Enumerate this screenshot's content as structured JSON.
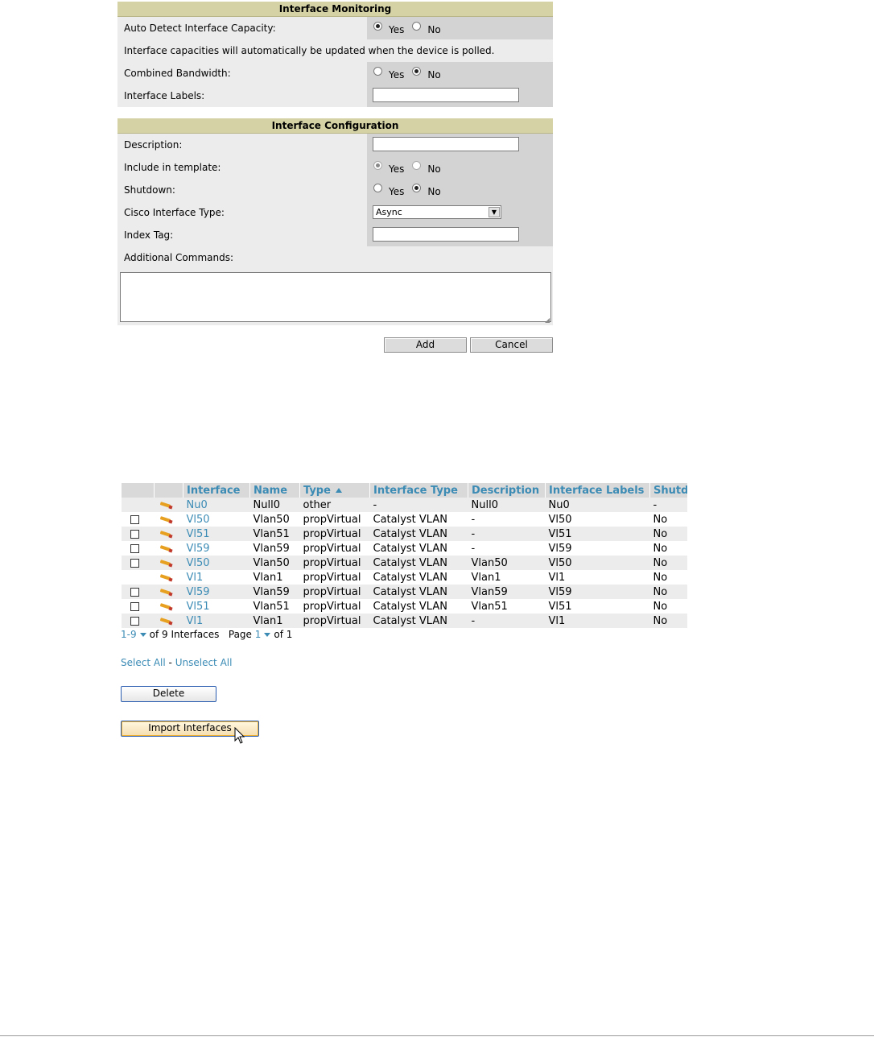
{
  "monitoring": {
    "title": "Interface Monitoring",
    "auto_detect_label": "Auto Detect Interface Capacity:",
    "auto_detect_yes": "Yes",
    "auto_detect_no": "No",
    "auto_detect_selected": "Yes",
    "note": "Interface capacities will automatically be updated when the device is polled.",
    "combined_label": "Combined Bandwidth:",
    "combined_yes": "Yes",
    "combined_no": "No",
    "combined_selected": "No",
    "labels_label": "Interface Labels:",
    "labels_value": ""
  },
  "configuration": {
    "title": "Interface Configuration",
    "description_label": "Description:",
    "description_value": "",
    "include_label": "Include in template:",
    "include_yes": "Yes",
    "include_no": "No",
    "include_selected": "Yes",
    "shutdown_label": "Shutdown:",
    "shutdown_yes": "Yes",
    "shutdown_no": "No",
    "shutdown_selected": "No",
    "cisco_type_label": "Cisco Interface Type:",
    "cisco_type_value": "Async",
    "index_tag_label": "Index Tag:",
    "index_tag_value": "",
    "additional_label": "Additional Commands:",
    "additional_value": ""
  },
  "form_buttons": {
    "add": "Add",
    "cancel": "Cancel"
  },
  "table": {
    "columns": [
      "Interface",
      "Name",
      "Type",
      "Interface Type",
      "Description",
      "Interface Labels",
      "Shutd"
    ],
    "sorted_column": "Type",
    "rows": [
      {
        "checkbox": false,
        "interface": "Nu0",
        "name": "Null0",
        "type": "other",
        "itype": "-",
        "description": "Null0",
        "labels": "Nu0",
        "shutdown": "-"
      },
      {
        "checkbox": true,
        "interface": "Vl50",
        "name": "Vlan50",
        "type": "propVirtual",
        "itype": "Catalyst VLAN",
        "description": "-",
        "labels": "Vl50",
        "shutdown": "No"
      },
      {
        "checkbox": true,
        "interface": "Vl51",
        "name": "Vlan51",
        "type": "propVirtual",
        "itype": "Catalyst VLAN",
        "description": "-",
        "labels": "Vl51",
        "shutdown": "No"
      },
      {
        "checkbox": true,
        "interface": "Vl59",
        "name": "Vlan59",
        "type": "propVirtual",
        "itype": "Catalyst VLAN",
        "description": "-",
        "labels": "Vl59",
        "shutdown": "No"
      },
      {
        "checkbox": true,
        "interface": "Vl50",
        "name": "Vlan50",
        "type": "propVirtual",
        "itype": "Catalyst VLAN",
        "description": "Vlan50",
        "labels": "Vl50",
        "shutdown": "No"
      },
      {
        "checkbox": false,
        "interface": "Vl1",
        "name": "Vlan1",
        "type": "propVirtual",
        "itype": "Catalyst VLAN",
        "description": "Vlan1",
        "labels": "Vl1",
        "shutdown": "No"
      },
      {
        "checkbox": true,
        "interface": "Vl59",
        "name": "Vlan59",
        "type": "propVirtual",
        "itype": "Catalyst VLAN",
        "description": "Vlan59",
        "labels": "Vl59",
        "shutdown": "No"
      },
      {
        "checkbox": true,
        "interface": "Vl51",
        "name": "Vlan51",
        "type": "propVirtual",
        "itype": "Catalyst VLAN",
        "description": "Vlan51",
        "labels": "Vl51",
        "shutdown": "No"
      },
      {
        "checkbox": true,
        "interface": "Vl1",
        "name": "Vlan1",
        "type": "propVirtual",
        "itype": "Catalyst VLAN",
        "description": "-",
        "labels": "Vl1",
        "shutdown": "No"
      }
    ]
  },
  "pager": {
    "range": "1-9",
    "of_text": "of 9 Interfaces",
    "page_label": "Page",
    "page": "1",
    "of_pages": "of 1"
  },
  "selection": {
    "select_all": "Select All",
    "separator": "-",
    "unselect_all": "Unselect All"
  },
  "actions": {
    "delete": "Delete",
    "import": "Import Interfaces"
  },
  "colors": {
    "header_band": "#d5d3a6",
    "link": "#3b8bb5",
    "label_bg": "#ececec",
    "value_bg": "#d3d3d3"
  },
  "icons": {
    "edit": "pencil-icon",
    "sort": "sort-ascending-icon",
    "dropdown": "chevron-down-icon",
    "cursor": "mouse-pointer-icon"
  }
}
